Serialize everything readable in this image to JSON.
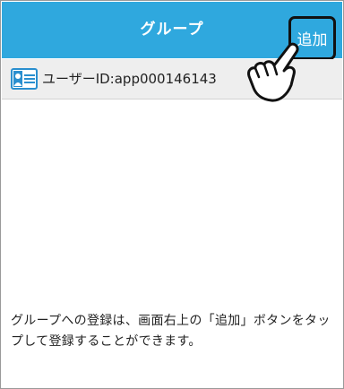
{
  "header": {
    "title": "グループ",
    "add_label": "追加",
    "color": "#2fa8de"
  },
  "user": {
    "id_label": "ユーザーID:app000146143",
    "icon": "id-card-icon"
  },
  "pointer_icon": "hand-pointer-icon",
  "message": "グループへの登録は、画面右上の「追加」ボタンをタップして登録することができます。"
}
